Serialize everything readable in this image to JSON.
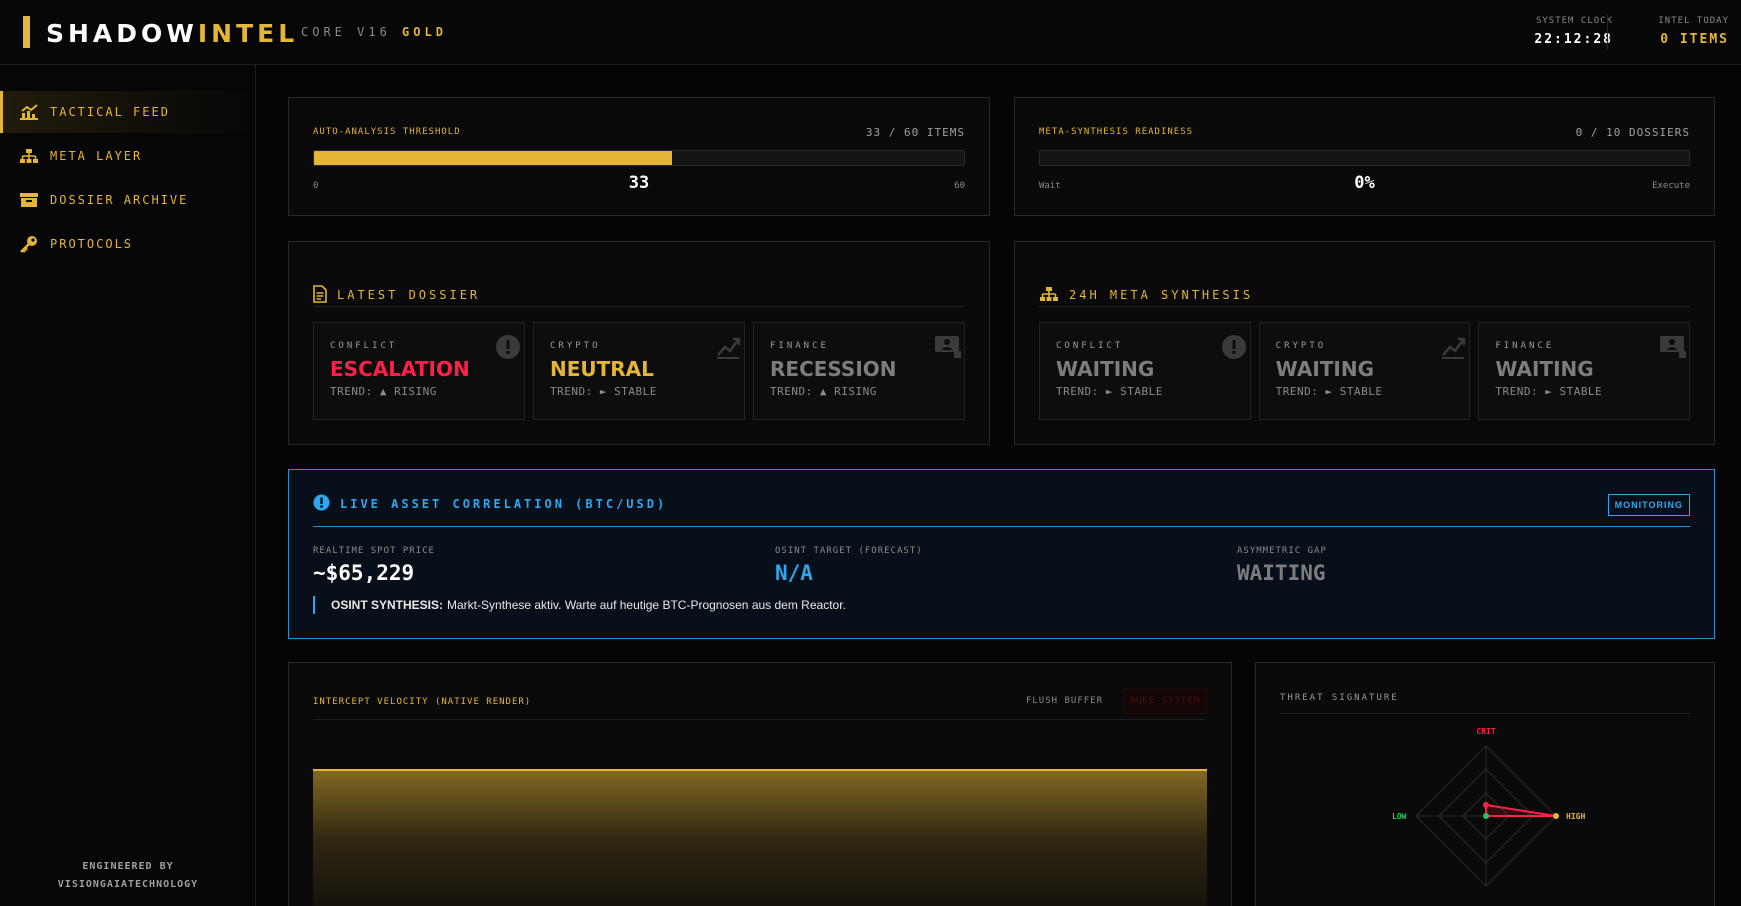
{
  "header": {
    "logo_a": "SHADOW",
    "logo_b": "INTEL",
    "core_a": "CORE V16",
    "core_b": "GOLD",
    "clock_label": "SYSTEM CLOCK",
    "clock_value": "22:12:28",
    "intel_label": "INTEL TODAY",
    "intel_value": "0 ITEMS"
  },
  "sidebar": {
    "items": [
      {
        "label": "TACTICAL FEED",
        "icon": "chart-icon"
      },
      {
        "label": "META LAYER",
        "icon": "sitemap-icon"
      },
      {
        "label": "DOSSIER ARCHIVE",
        "icon": "archive-icon"
      },
      {
        "label": "PROTOCOLS",
        "icon": "key-icon"
      }
    ],
    "credit_1": "ENGINEERED BY",
    "credit_2": "VISIONGAIATECHNOLOGY"
  },
  "threshold": {
    "label": "AUTO-ANALYSIS THRESHOLD",
    "count": "33 / 60 ITEMS",
    "min": "0",
    "max": "60",
    "value": "33",
    "fraction": 0.55
  },
  "meta_ready": {
    "label": "META-SYNTHESIS READINESS",
    "count": "0 / 10 DOSSIERS",
    "min": "Wait",
    "max": "Execute",
    "value": "0%",
    "fraction": 0
  },
  "latest": {
    "title": "LATEST DOSSIER",
    "cards": [
      {
        "cat": "CONFLICT",
        "state": "ESCALATION",
        "trend": "TREND: ▲ RISING",
        "color": "#ff1f4b"
      },
      {
        "cat": "CRYPTO",
        "state": "NEUTRAL",
        "trend": "TREND: ► STABLE",
        "color": "#e4b536"
      },
      {
        "cat": "FINANCE",
        "state": "RECESSION",
        "trend": "TREND: ▲ RISING",
        "color": "#7d7d7d"
      }
    ]
  },
  "meta24": {
    "title": "24H META SYNTHESIS",
    "cards": [
      {
        "cat": "CONFLICT",
        "state": "WAITING",
        "trend": "TREND: ► STABLE",
        "color": "#7d7d7d"
      },
      {
        "cat": "CRYPTO",
        "state": "WAITING",
        "trend": "TREND: ► STABLE",
        "color": "#7d7d7d"
      },
      {
        "cat": "FINANCE",
        "state": "WAITING",
        "trend": "TREND: ► STABLE",
        "color": "#7d7d7d"
      }
    ]
  },
  "btc": {
    "title": "LIVE ASSET CORRELATION (BTC/USD)",
    "button": "MONITORING",
    "spot_label": "REALTIME SPOT PRICE",
    "spot_value": "~$65,229",
    "target_label": "OSINT TARGET (FORECAST)",
    "target_value": "N/A",
    "gap_label": "ASYMMETRIC GAP",
    "gap_value": "WAITING",
    "synth_label": "OSINT SYNTHESIS:",
    "synth_text": "Markt-Synthese aktiv. Warte auf heutige BTC-Prognosen aus dem Reactor."
  },
  "velocity": {
    "title": "INTERCEPT VELOCITY (NATIVE RENDER)",
    "flush": "FLUSH BUFFER",
    "nuke": "NUKE SYSTEM"
  },
  "threat": {
    "title": "THREAT SIGNATURE",
    "crit": "CRIT",
    "high": "HIGH",
    "low": "LOW"
  },
  "colors": {
    "gold": "#e4b536",
    "blue": "#2da8f0",
    "red": "#ff1f4b",
    "green": "#22c55e"
  }
}
